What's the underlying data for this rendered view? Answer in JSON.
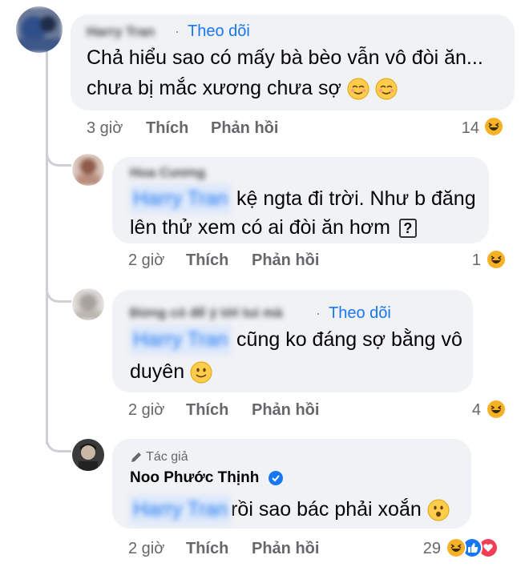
{
  "comments": [
    {
      "name": "Harry Tran",
      "follow": "Theo dõi",
      "lines": [
        "Chả hiểu sao có mấy bà bèo vẫn vô đòi ăn...",
        "chưa bị mắc xương chưa sợ"
      ],
      "time": "3 giờ",
      "like": "Thích",
      "reply": "Phản hồi",
      "reactions": "14"
    },
    {
      "name": "Hoa Cương",
      "mention": "Harry Tran",
      "lines": [
        "kệ ngta đi trời. Như b đăng",
        "lên thử xem có ai đòi ăn hơm"
      ],
      "time": "2 giờ",
      "like": "Thích",
      "reply": "Phản hồi",
      "reactions": "1"
    },
    {
      "name": "Đừng có để ý tới tui mà",
      "follow": "Theo dõi",
      "mention": "Harry Tran",
      "lines": [
        "cũng ko đáng sợ bằng vô",
        "duyên"
      ],
      "time": "2 giờ",
      "like": "Thích",
      "reply": "Phản hồi",
      "reactions": "4"
    },
    {
      "author_badge": "Tác giả",
      "name": "Noo Phước Thịnh",
      "mention": "Harry Tran",
      "lines": [
        "rồi sao bác phải xoắn"
      ],
      "time": "2 giờ",
      "like": "Thích",
      "reply": "Phản hồi",
      "reactions": "29"
    }
  ],
  "colors": {
    "link": "#1877f2",
    "bubble": "#f0f2f5",
    "meta": "#65676b",
    "haha": "#f7b125",
    "like": "#1877f2",
    "love": "#f33e58"
  },
  "icons": [
    "pencil-icon",
    "verified-icon",
    "haha-reaction-icon",
    "like-reaction-icon",
    "love-reaction-icon",
    "relieved-emoji",
    "slight-smile-emoji",
    "hushed-emoji"
  ]
}
